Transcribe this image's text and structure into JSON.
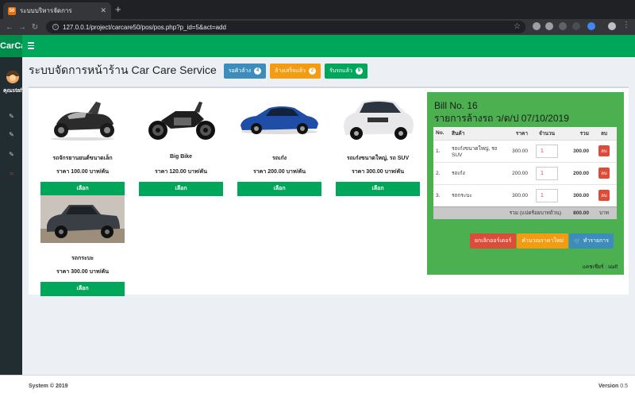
{
  "browser": {
    "tab_title": "ระบบบริหารจัดการ",
    "favicon_text": "50",
    "url": "127.0.0.1/project/carcare50/pos/pos.php?p_id=5&act=add"
  },
  "app": {
    "logo": "CarCare",
    "username": "คุณstaff"
  },
  "header": {
    "title": "ระบบจัดการหน้าร้าน Car Care Service",
    "buttons": [
      {
        "label": "รอคิวล้าง",
        "count": "4",
        "color": "#3c8dbc"
      },
      {
        "label": "ล้างเสร็จแล้ว",
        "count": "2",
        "color": "#f39c12"
      },
      {
        "label": "รับรถแล้ว",
        "count": "9",
        "color": "#00a65a"
      }
    ]
  },
  "products": [
    {
      "name": "รถจักรยานยนต์ขนาดเล็ก",
      "price": "ราคา 100.00 บาท/คัน",
      "button": "เลือก",
      "icon": "scooter-image"
    },
    {
      "name": "Big Bike",
      "price": "ราคา 120.00 บาท/คัน",
      "button": "เลือก",
      "icon": "bigbike-image"
    },
    {
      "name": "รถเก๋ง",
      "price": "ราคา 200.00 บาท/คัน",
      "button": "เลือก",
      "icon": "sedan-image"
    },
    {
      "name": "รถเก๋งขนาดใหญ่, รถ SUV",
      "price": "ราคา 300.00 บาท/คัน",
      "button": "เลือก",
      "icon": "suv-image"
    },
    {
      "name": "รถกระบะ",
      "price": "ราคา 300.00 บาท/คัน",
      "button": "เลือก",
      "icon": "pickup-image"
    }
  ],
  "bill": {
    "number": "Bill No. 16",
    "title": "รายการล้างรถ ว/ด/ป 07/10/2019",
    "columns": [
      "No.",
      "สินค้า",
      "ราคา",
      "จำนวน",
      "รวม",
      "ลบ"
    ],
    "rows": [
      {
        "no": "1.",
        "item": "รถเก๋งขนาดใหญ่, รถ SUV",
        "price": "300.00",
        "qty": "1",
        "total": "300.00",
        "del": "ลบ"
      },
      {
        "no": "2.",
        "item": "รถเก๋ง",
        "price": "200.00",
        "qty": "1",
        "total": "200.00",
        "del": "ลบ"
      },
      {
        "no": "3.",
        "item": "รถกระบะ",
        "price": "300.00",
        "qty": "1",
        "total": "300.00",
        "del": "ลบ"
      }
    ],
    "total_label": "รวม (แปดร้อยบาทถ้วน)",
    "total_value": "800.00",
    "total_unit": "บาท",
    "btn_cancel": "ยกเลิกออร์เดอร์",
    "btn_recalc": "คำนวณราคาใหม่",
    "btn_submit": "ทำรายการ",
    "cashier": "แคชเชียร์ : staff"
  },
  "footer": {
    "left": "System © 2019",
    "version_label": "Version",
    "version_value": "0.5"
  }
}
